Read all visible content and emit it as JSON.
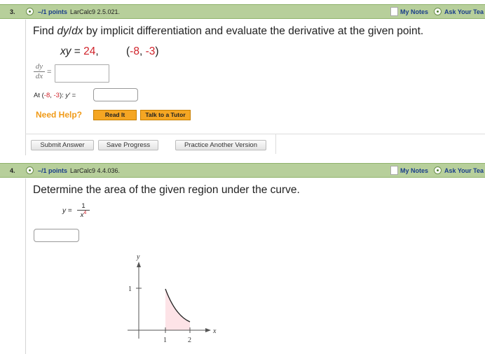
{
  "q3": {
    "number": "3.",
    "points": "–/1 points",
    "source": "LarCalc9 2.5.021.",
    "my_notes": "My Notes",
    "ask": "Ask Your Tea",
    "prompt_a": "Find ",
    "prompt_b": "dy",
    "prompt_c": "/",
    "prompt_d": "dx",
    "prompt_e": " by implicit differentiation and evaluate the derivative at the given point.",
    "eq_lhs": "xy",
    "eq_eq": " = ",
    "eq_val": "24",
    "eq_comma": ",",
    "pt_open": "(",
    "pt_x": "-8",
    "pt_sep": ", ",
    "pt_y": "-3",
    "pt_close": ")",
    "frac_num": "dy",
    "frac_den": "dx",
    "frac_eq": "=",
    "at_a": "At (",
    "at_x": "-8",
    "at_sep": ", ",
    "at_y": "-3",
    "at_b": "): ",
    "at_c": "y′",
    "at_d": " =",
    "need_help": "Need Help?",
    "read_it": "Read It",
    "talk_tutor": "Talk to a Tutor",
    "submit": "Submit Answer",
    "save": "Save Progress",
    "practice": "Practice Another Version"
  },
  "q4": {
    "number": "4.",
    "points": "–/1 points",
    "source": "LarCalc9 4.4.036.",
    "my_notes": "My Notes",
    "ask": "Ask Your Tea",
    "prompt": "Determine the area of the given region under the curve.",
    "y_label": "y =",
    "num": "1",
    "den_base": "x",
    "den_exp": "4",
    "graph": {
      "y_axis": "y",
      "x_axis": "x",
      "tick_y1": "1",
      "tick_x1": "1",
      "tick_x2": "2",
      "shade_color": "#fde3e7"
    }
  },
  "colors": {
    "bar": "#b7cf9b",
    "link": "#1a3e8a",
    "red": "#d0222a",
    "orange": "#f5a623"
  }
}
